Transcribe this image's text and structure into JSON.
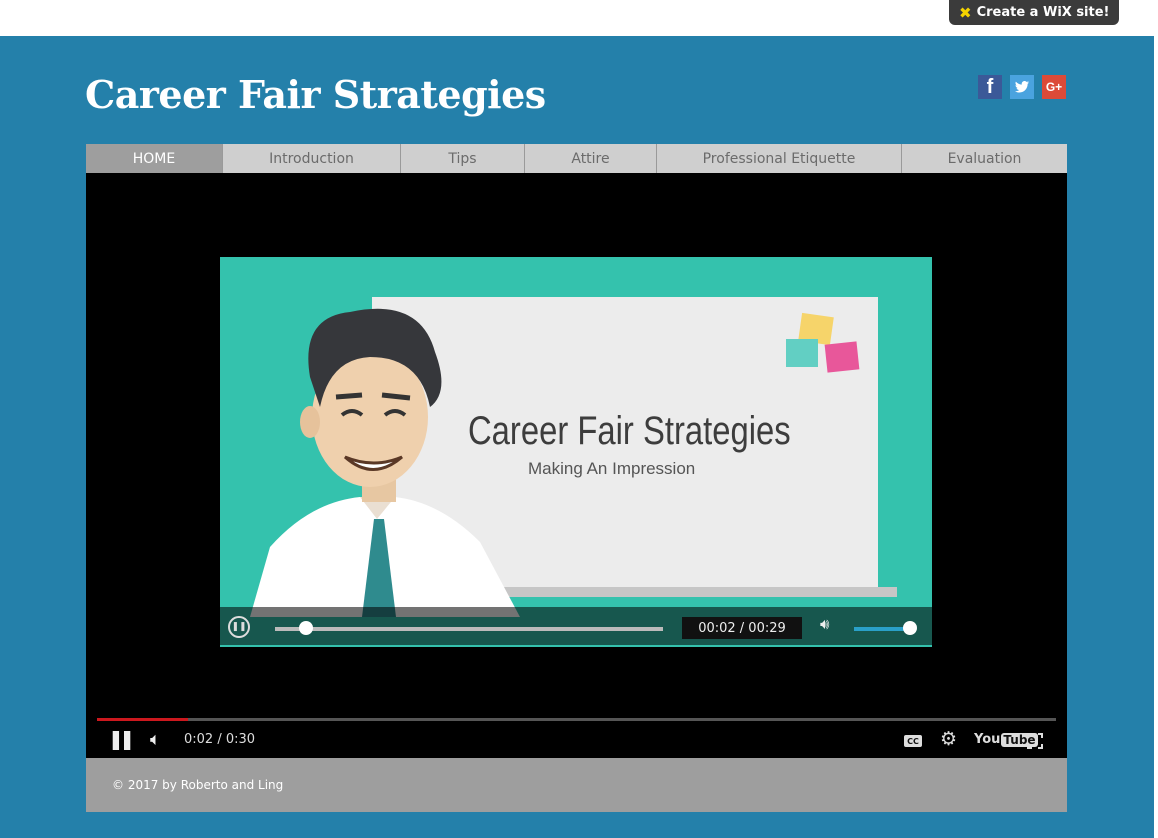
{
  "header": {
    "site_title": "Career Fair Strategies",
    "wix_badge": "Create a WiX site!"
  },
  "social": [
    {
      "name": "facebook-icon",
      "glyph": "f"
    },
    {
      "name": "twitter-icon",
      "glyph": "t"
    },
    {
      "name": "google-plus-icon",
      "glyph": "G+"
    }
  ],
  "nav": {
    "items": [
      {
        "label": "HOME",
        "active": true
      },
      {
        "label": "Introduction",
        "active": false
      },
      {
        "label": "Tips",
        "active": false
      },
      {
        "label": "Attire",
        "active": false
      },
      {
        "label": "Professional Etiquette",
        "active": false
      },
      {
        "label": "Evaluation",
        "active": false
      }
    ]
  },
  "video": {
    "board_title": "Career Fair Strategies",
    "board_subtitle": "Making An Impression",
    "inner_time": "00:02 / 00:29",
    "inner_progress": 0.08,
    "inner_volume": 0.9,
    "player_time": "0:02 / 0:30",
    "player_progress": 0.095,
    "yt_logo_you": "You",
    "yt_logo_tube": "Tube",
    "cc_label": "CC"
  },
  "footer": {
    "copyright": "© 2017 by Roberto and Ling"
  },
  "colors": {
    "page_bg": "#2480aa",
    "nav_bg": "#cfcfcf",
    "nav_active": "#9e9e9e",
    "footer_bg": "#9e9e9e",
    "video_teal": "#34c2ad",
    "progress_red": "#cc181e"
  }
}
